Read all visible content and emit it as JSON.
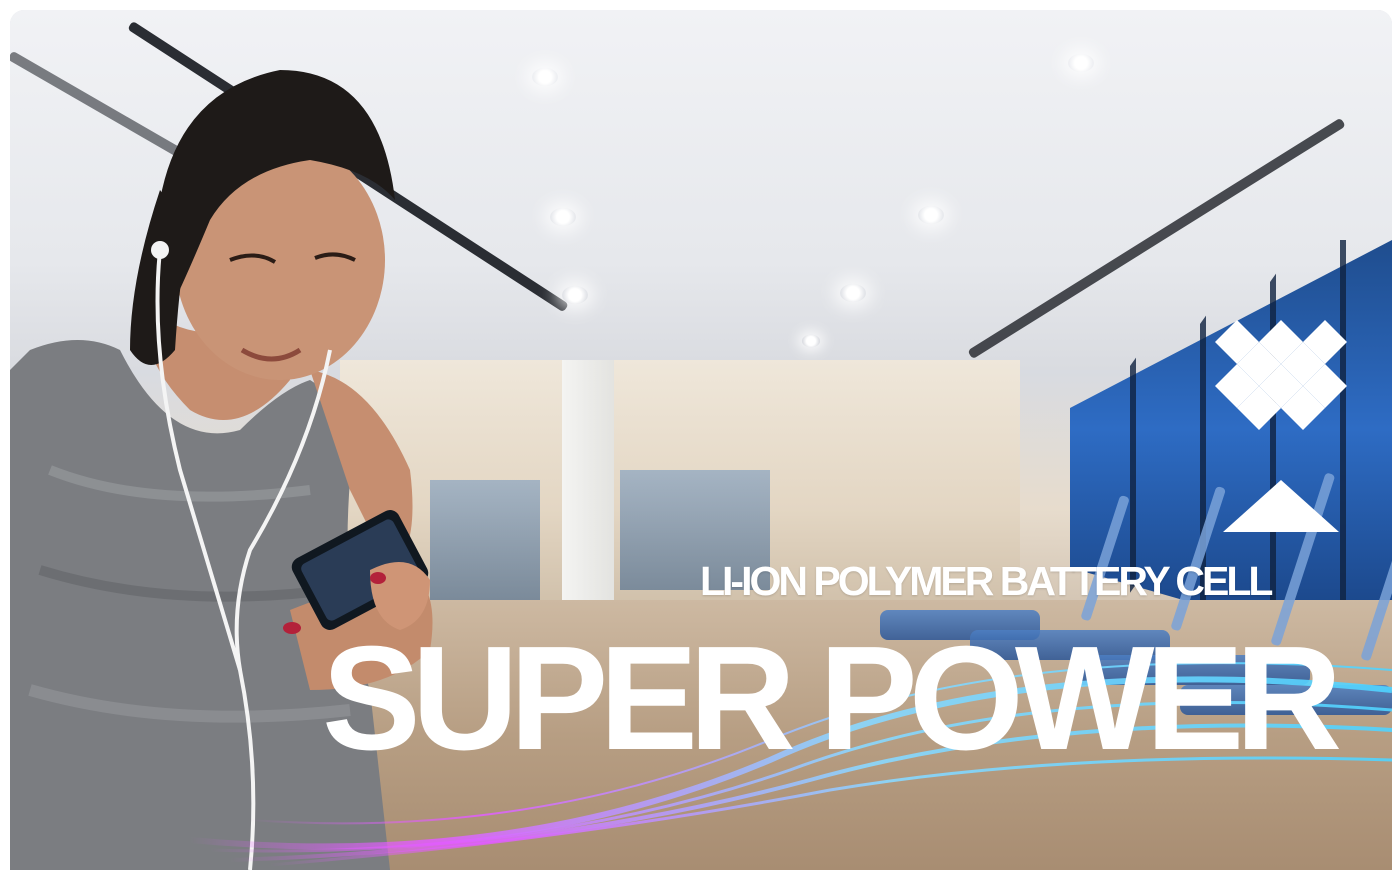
{
  "banner": {
    "subtitle": "LI-ION POLYMER BATTERY CELL",
    "headline": "SUPER POWER"
  },
  "colors": {
    "text": "#ffffff",
    "window_blue": "#2e6cc4",
    "wave_cyan": "#4fd3ff",
    "wave_magenta": "#e25cff"
  },
  "icons": {
    "logo": "diamond-grid-triangle-logo"
  }
}
